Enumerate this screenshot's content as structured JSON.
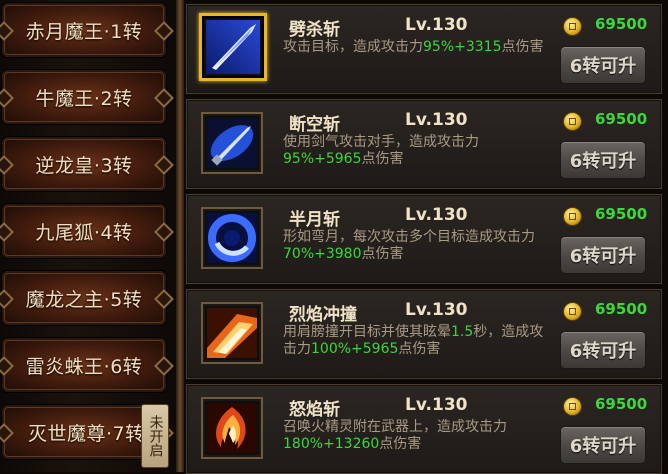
{
  "sidebar": {
    "tabs": [
      {
        "label": "赤月魔王·1转"
      },
      {
        "label": "牛魔王·2转"
      },
      {
        "label": "逆龙皇·3转"
      },
      {
        "label": "九尾狐·4转"
      },
      {
        "label": "魔龙之主·5转"
      },
      {
        "label": "雷炎蛛王·6转"
      },
      {
        "label": "灭世魔尊·7转"
      }
    ],
    "locked_badge": "未开启"
  },
  "skills": [
    {
      "name": "劈杀斩",
      "level": "Lv.130",
      "desc_prefix": "攻击目标，造成攻击力",
      "desc_value": "95%+3315",
      "desc_suffix": "点伤害",
      "cost": "69500",
      "button": "6转可升",
      "selected": true
    },
    {
      "name": "断空斩",
      "level": "Lv.130",
      "desc_prefix": "使用剑气攻击对手，造成攻击力",
      "desc_value": "95%+5965",
      "desc_suffix": "点伤害",
      "cost": "69500",
      "button": "6转可升",
      "selected": false
    },
    {
      "name": "半月斩",
      "level": "Lv.130",
      "desc_prefix": "形如弯月，每次攻击多个目标造成攻击力",
      "desc_value": "70%+3980",
      "desc_suffix": "点伤害",
      "cost": "69500",
      "button": "6转可升",
      "selected": false
    },
    {
      "name": "烈焰冲撞",
      "level": "Lv.130",
      "desc_prefix": "用肩膀撞开目标并使其眩晕",
      "desc_value": "1.5",
      "desc_mid": "秒，造成攻击力",
      "desc_value2": "100%+5965",
      "desc_suffix": "点伤害",
      "cost": "69500",
      "button": "6转可升",
      "selected": false
    },
    {
      "name": "怒焰斩",
      "level": "Lv.130",
      "desc_prefix": "召唤火精灵附在武器上，造成攻击力",
      "desc_value": "180%+13260",
      "desc_suffix": "点伤害",
      "cost": "69500",
      "button": "6转可升",
      "selected": false
    }
  ],
  "icons": [
    "sword-slash-icon",
    "sword-beam-icon",
    "crescent-slash-icon",
    "flame-charge-icon",
    "flame-sword-icon",
    "gold-coin-icon"
  ],
  "colors": {
    "highlight": "#3cd73c",
    "selected_frame": "#e9b62a",
    "label": "#f0e2c6",
    "desc": "#a99a85"
  }
}
